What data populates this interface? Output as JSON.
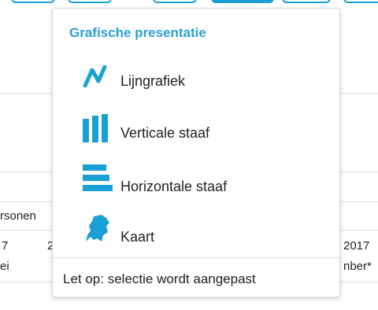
{
  "background": {
    "row_header": "rsonen",
    "row1": {
      "left": "7",
      "mid": "2",
      "right": "2017"
    },
    "row2": {
      "left": "ei",
      "right": "nber*"
    }
  },
  "popup": {
    "title": "Grafische presentatie",
    "items": [
      {
        "label": "Lijngrafiek",
        "icon": "line-chart-icon"
      },
      {
        "label": "Verticale staaf",
        "icon": "vertical-bar-icon"
      },
      {
        "label": "Horizontale staaf",
        "icon": "horizontal-bar-icon"
      },
      {
        "label": "Kaart",
        "icon": "netherlands-map-icon"
      }
    ],
    "notice": "Let op: selectie wordt aangepast"
  },
  "colors": {
    "accent": "#1aa0d4",
    "title": "#2d9fd3"
  }
}
